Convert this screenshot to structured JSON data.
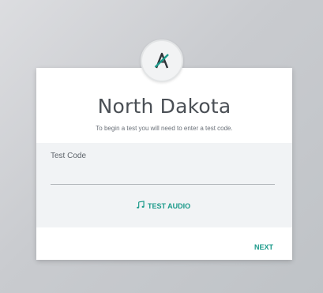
{
  "logo": {
    "icon": "ndsa-logo-icon",
    "letter": "A",
    "accent": "#1b9a8a"
  },
  "title": "North Dakota",
  "subtitle": "To begin a test you will need to enter a test code.",
  "form": {
    "label": "Test Code",
    "value": "",
    "placeholder": ""
  },
  "actions": {
    "test_audio_label": "TEST AUDIO",
    "test_audio_icon": "music-note-icon",
    "next_label": "NEXT"
  }
}
